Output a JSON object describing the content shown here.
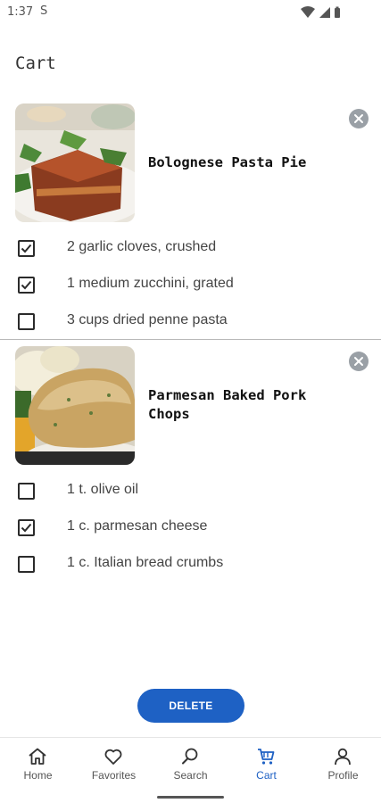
{
  "status": {
    "time": "1:37",
    "notif_icon": "s-notification-icon"
  },
  "page": {
    "title": "Cart"
  },
  "recipes": [
    {
      "name": "Bolognese Pasta Pie",
      "image": "bolognese-pasta-pie-photo",
      "ingredients": [
        {
          "label": "2 garlic cloves, crushed",
          "checked": true
        },
        {
          "label": "1 medium zucchini, grated",
          "checked": true
        },
        {
          "label": "3 cups dried penne pasta",
          "checked": false
        }
      ]
    },
    {
      "name": "Parmesan Baked Pork Chops",
      "image": "parmesan-pork-chops-photo",
      "ingredients": [
        {
          "label": "1 t. olive oil",
          "checked": false
        },
        {
          "label": "1 c. parmesan cheese",
          "checked": true
        },
        {
          "label": "1 c. Italian bread crumbs",
          "checked": false
        }
      ]
    }
  ],
  "actions": {
    "delete_label": "DELETE"
  },
  "nav": {
    "active": "Cart",
    "accent": "#1e61c4",
    "items": [
      {
        "label": "Home",
        "icon": "home-icon"
      },
      {
        "label": "Favorites",
        "icon": "heart-icon"
      },
      {
        "label": "Search",
        "icon": "search-icon"
      },
      {
        "label": "Cart",
        "icon": "cart-icon"
      },
      {
        "label": "Profile",
        "icon": "person-icon"
      }
    ]
  }
}
